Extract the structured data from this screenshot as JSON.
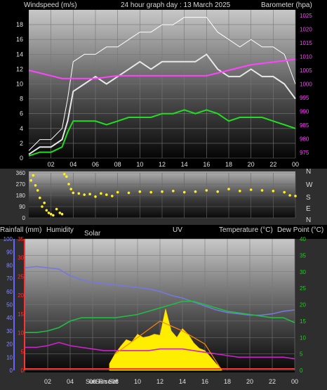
{
  "header": {
    "left": "Windspeed (m/s)",
    "center": "24 hour graph day : 13 March 2025",
    "right": "Barometer (hpa)"
  },
  "mid_header": {
    "rainfall": "Rainfall (mm)",
    "humidity": "Humidity",
    "solar": "Solar",
    "uv": "UV",
    "temperature": "Temperature (°C)",
    "dewpoint": "Dew Point (°C)"
  },
  "compass": [
    "N",
    "W",
    "S",
    "E",
    "N"
  ],
  "sun_labels": {
    "sunrise": "Sun Rise",
    "sunset": "Sun Set"
  },
  "colors": {
    "wind": "#e8e8e8",
    "gust": "#ffffff",
    "avgwind": "#22dd22",
    "baro": "#ff44ff",
    "winddir": "#ffee22",
    "rain_axis": "#ff3333",
    "humidity_axis": "#6666ff",
    "temperature_axis": "#22cc22",
    "uv": "#ff8800"
  },
  "chart_data": [
    {
      "type": "line",
      "name": "wind-barometer",
      "title": "24 hour graph day : 13 March 2025",
      "x_ticks": [
        "02",
        "04",
        "06",
        "08",
        "10",
        "12",
        "14",
        "16",
        "18",
        "20",
        "22",
        "00"
      ],
      "xlim": [
        0,
        24
      ],
      "ylim_left": [
        0,
        20
      ],
      "y_ticks_left": [
        0,
        2,
        4,
        6,
        8,
        10,
        12,
        14,
        16,
        18
      ],
      "ylim_right": [
        973,
        1027
      ],
      "y_ticks_right": [
        975,
        980,
        985,
        990,
        995,
        1000,
        1005,
        1010,
        1015,
        1020,
        1025
      ],
      "series": [
        {
          "key": "wind",
          "x": [
            0,
            1,
            2,
            3,
            3.5,
            4,
            5,
            6,
            7,
            8,
            9,
            10,
            11,
            12,
            13,
            14,
            15,
            16,
            17,
            18,
            19,
            20,
            21,
            22,
            23,
            24
          ],
          "values": [
            0.5,
            1.5,
            1.5,
            2.5,
            5,
            9,
            10,
            11,
            10,
            11,
            12,
            13,
            12,
            13,
            13,
            13,
            13,
            14,
            12,
            11,
            11,
            12,
            11,
            11,
            10,
            8
          ]
        },
        {
          "key": "gust",
          "x": [
            0,
            1,
            2,
            3,
            3.5,
            4,
            5,
            6,
            7,
            8,
            9,
            10,
            11,
            12,
            13,
            14,
            15,
            16,
            17,
            18,
            19,
            20,
            21,
            22,
            23,
            24
          ],
          "values": [
            1,
            2.5,
            2.5,
            4,
            8,
            13,
            14,
            14,
            15,
            15,
            16,
            17,
            17,
            18,
            18,
            19,
            19,
            19,
            17,
            16,
            15,
            16,
            15,
            15,
            14,
            10
          ]
        },
        {
          "key": "avgwind",
          "x": [
            0,
            1,
            2,
            3,
            3.5,
            4,
            5,
            6,
            7,
            8,
            9,
            10,
            11,
            12,
            13,
            14,
            15,
            16,
            17,
            18,
            19,
            20,
            21,
            22,
            23,
            24
          ],
          "values": [
            0.3,
            0.8,
            0.8,
            1.5,
            3.5,
            5,
            5,
            5,
            4.5,
            5,
            5.5,
            5.5,
            5.5,
            6,
            6,
            6.5,
            6,
            6.5,
            6,
            5,
            5.5,
            5.5,
            5.5,
            5,
            4.5,
            4
          ]
        },
        {
          "key": "baro",
          "x": [
            0,
            1,
            2,
            3,
            4,
            5,
            6,
            7,
            8,
            9,
            10,
            11,
            12,
            13,
            14,
            15,
            16,
            17,
            18,
            19,
            20,
            21,
            22,
            23,
            24
          ],
          "values": [
            1005,
            1004,
            1003,
            1002,
            1002,
            1002,
            1002,
            1002.5,
            1003,
            1003,
            1003,
            1003,
            1003,
            1003,
            1003,
            1003,
            1003,
            1004,
            1005,
            1006,
            1007,
            1007.5,
            1008,
            1008.5,
            1009
          ]
        }
      ]
    },
    {
      "type": "scatter",
      "name": "wind-direction",
      "x_ticks": [
        "02",
        "04",
        "06",
        "08",
        "10",
        "12",
        "14",
        "16",
        "18",
        "20",
        "22",
        "00"
      ],
      "xlim": [
        0,
        24
      ],
      "ylim": [
        0,
        360
      ],
      "y_ticks": [
        0,
        90,
        180,
        270,
        360
      ],
      "x": [
        0.2,
        0.4,
        0.6,
        0.8,
        1.0,
        1.2,
        1.4,
        1.6,
        1.8,
        2.0,
        2.2,
        2.5,
        2.8,
        3.0,
        3.2,
        3.4,
        3.6,
        3.8,
        4,
        4.5,
        5,
        5.5,
        6,
        6.5,
        7,
        7.5,
        8,
        9,
        10,
        11,
        12,
        13,
        14,
        15,
        16,
        17,
        18,
        19,
        20,
        21,
        22,
        23,
        23.5,
        24
      ],
      "values": [
        300,
        340,
        260,
        220,
        160,
        90,
        120,
        60,
        40,
        30,
        20,
        70,
        40,
        30,
        350,
        330,
        270,
        230,
        200,
        195,
        185,
        190,
        170,
        195,
        185,
        175,
        205,
        200,
        210,
        205,
        210,
        215,
        205,
        210,
        220,
        210,
        230,
        215,
        225,
        220,
        215,
        205,
        180,
        175
      ]
    },
    {
      "type": "line",
      "name": "temperature-humidity-solar",
      "x_ticks": [
        "02",
        "04",
        "06",
        "08",
        "10",
        "12",
        "14",
        "16",
        "18",
        "20",
        "22",
        "00"
      ],
      "xlim": [
        0,
        24
      ],
      "ylim_humidity": [
        0,
        100
      ],
      "y_ticks_humidity": [
        0,
        10,
        20,
        30,
        40,
        50,
        60,
        70,
        80,
        90,
        100
      ],
      "ylim_rain": [
        0,
        35
      ],
      "y_ticks_rain": [
        0,
        5,
        10,
        15,
        20,
        25,
        30,
        35
      ],
      "ylim_temperature": [
        0,
        40
      ],
      "y_ticks_temperature": [
        0,
        5,
        10,
        15,
        20,
        25,
        30,
        35,
        40
      ],
      "series": [
        {
          "key": "humidity",
          "axis": "humidity",
          "x": [
            0,
            1,
            2,
            3,
            4,
            5,
            6,
            7,
            8,
            9,
            10,
            11,
            12,
            13,
            14,
            15,
            16,
            17,
            18,
            19,
            20,
            21,
            22,
            23,
            24
          ],
          "values": [
            78,
            79,
            78,
            77,
            72,
            69,
            67,
            66,
            65,
            64,
            63,
            62,
            60,
            57,
            55,
            52,
            49,
            46,
            44,
            43,
            42,
            42,
            43,
            45,
            46
          ]
        },
        {
          "key": "temperature",
          "axis": "temperature",
          "x": [
            0,
            1,
            2,
            3,
            4,
            5,
            6,
            7,
            8,
            9,
            10,
            11,
            12,
            13,
            14,
            15,
            16,
            17,
            18,
            19,
            20,
            21,
            22,
            23,
            24
          ],
          "values": [
            11.5,
            11.5,
            12,
            13,
            15,
            16,
            16,
            16,
            16,
            16.5,
            17,
            18,
            19,
            20,
            21,
            21,
            20,
            19,
            18,
            17.5,
            17,
            16.5,
            16,
            16,
            14.5
          ]
        },
        {
          "key": "dewpoint",
          "axis": "temperature",
          "x": [
            0,
            1,
            2,
            3,
            4,
            5,
            6,
            7,
            8,
            9,
            10,
            11,
            12,
            13,
            14,
            15,
            16,
            17,
            18,
            19,
            20,
            21,
            22,
            23,
            24
          ],
          "values": [
            7,
            7,
            7.5,
            8.5,
            7.5,
            7,
            6.5,
            6,
            6,
            6,
            6,
            6,
            6.5,
            6.5,
            6.5,
            6,
            5.5,
            5,
            4.5,
            4,
            4,
            4,
            4,
            4,
            3.5
          ]
        },
        {
          "key": "solar",
          "axis": "solar",
          "x": [
            7.5,
            8,
            8.5,
            9,
            9.5,
            10,
            10.5,
            11,
            11.5,
            12,
            12.5,
            13,
            13.5,
            14,
            14.5,
            15,
            15.5,
            16,
            16.5,
            17,
            17.5
          ],
          "values": [
            60,
            150,
            220,
            280,
            260,
            330,
            300,
            310,
            330,
            320,
            560,
            360,
            300,
            380,
            330,
            250,
            200,
            180,
            120,
            60,
            10
          ]
        },
        {
          "key": "uv",
          "axis": "solar",
          "x": [
            8,
            10,
            12,
            14,
            16,
            17.5
          ],
          "values": [
            5,
            10,
            15,
            12,
            8,
            0
          ]
        }
      ]
    }
  ]
}
